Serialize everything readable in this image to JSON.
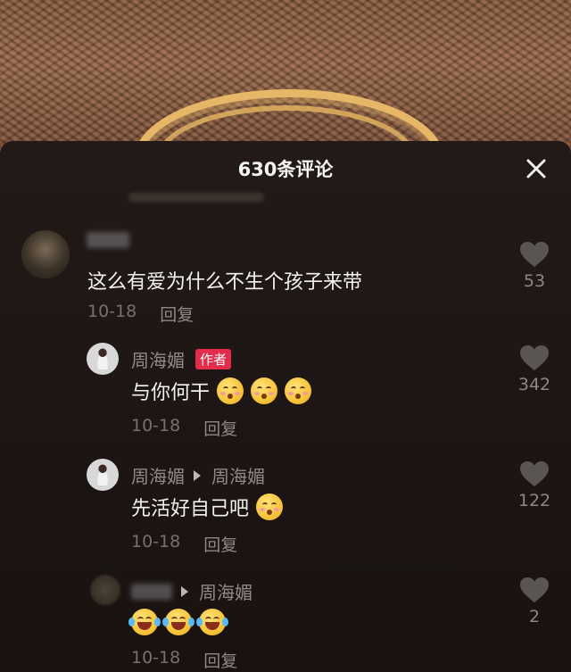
{
  "header": {
    "title": "630条评论"
  },
  "comments": [
    {
      "text": "这么有爱为什么不生个孩子来带",
      "date": "10-18",
      "reply_label": "回复",
      "likes": "53"
    },
    {
      "author": "周海媚",
      "badge": "作者",
      "text": "与你何干",
      "emoji_count": 3,
      "date": "10-18",
      "reply_label": "回复",
      "likes": "342"
    },
    {
      "author": "周海媚",
      "reply_to": "周海媚",
      "text": "先活好自己吧",
      "date": "10-18",
      "reply_label": "回复",
      "likes": "122"
    },
    {
      "reply_to": "周海媚",
      "emoji_count": 3,
      "date": "10-18",
      "reply_label": "回复",
      "likes": "2"
    }
  ],
  "colors": {
    "sheet_bg": "#1f1714",
    "author_badge": "#e32b4a",
    "primary_text": "#f2f2f2",
    "secondary_text": "#8f8a86"
  },
  "icons": {
    "close": "close-icon",
    "like": "heart-icon",
    "reply_arrow": "play-arrow-icon",
    "emoji_shy": "shy-face-emoji",
    "emoji_laugh": "tears-of-joy-emoji"
  }
}
